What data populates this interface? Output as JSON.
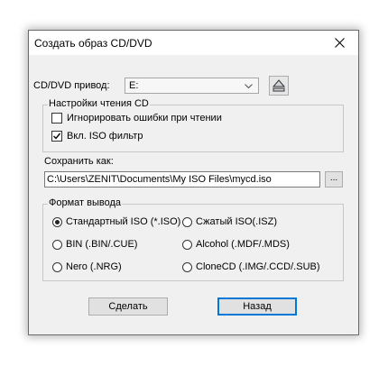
{
  "window": {
    "title": "Создать образ CD/DVD"
  },
  "drive": {
    "label": "CD/DVD привод:",
    "selected": "E:"
  },
  "read_settings": {
    "title": "Настройки чтения CD",
    "ignore_errors": {
      "label": "Игнорировать ошибки при чтении",
      "checked": false
    },
    "iso_filter": {
      "label": "Вкл. ISO фильтр",
      "checked": true
    }
  },
  "save_as": {
    "label": "Сохранить как:",
    "path": "C:\\Users\\ZENIT\\Documents\\My ISO Files\\mycd.iso",
    "browse_label": "..."
  },
  "output_format": {
    "title": "Формат вывода",
    "options": [
      {
        "label": "Стандартный ISO (*.ISO)",
        "selected": true
      },
      {
        "label": "Сжатый ISO(.ISZ)",
        "selected": false
      },
      {
        "label": "BIN (.BIN/.CUE)",
        "selected": false
      },
      {
        "label": "Alcohol (.MDF/.MDS)",
        "selected": false
      },
      {
        "label": "Nero (.NRG)",
        "selected": false
      },
      {
        "label": "CloneCD (.IMG/.CCD/.SUB)",
        "selected": false
      }
    ]
  },
  "buttons": {
    "make": "Сделать",
    "back": "Назад"
  }
}
